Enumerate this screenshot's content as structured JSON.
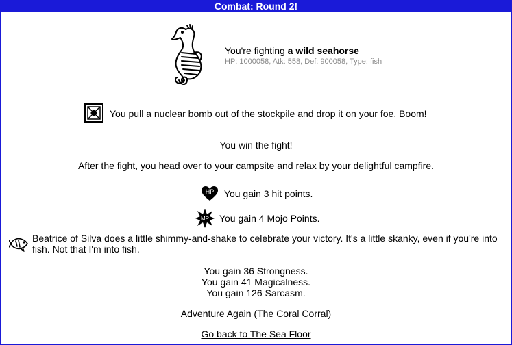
{
  "title": "Combat: Round 2!",
  "monster": {
    "icon": "seahorse-icon",
    "intro": "You're fighting ",
    "name": "a wild seahorse",
    "stats": "HP: 1000058, Atk: 558, Def: 900058, Type: fish"
  },
  "action": {
    "icon": "nuclear-bomb-crate-icon",
    "text": "You pull a nuclear bomb out of the stockpile and drop it on your foe. Boom!"
  },
  "result": {
    "win": "You win the fight!",
    "after": "After the fight, you head over to your campsite and relax by your delightful campfire."
  },
  "gains": {
    "hp_icon_label": "HP",
    "hp_text": "You gain 3 hit points.",
    "mp_icon_label": "MP",
    "mp_text": "You gain 4 Mojo Points."
  },
  "familiar": {
    "icon": "fish-familiar-icon",
    "text": "Beatrice of Silva does a little shimmy-and-shake to celebrate your victory. It's a little skanky, even if you're into fish. Not that I'm into fish."
  },
  "stats": {
    "strongness": "You gain 36 Strongness.",
    "magicalness": "You gain 41 Magicalness.",
    "sarcasm": "You gain 126 Sarcasm."
  },
  "links": {
    "adventure_again": "Adventure Again (The Coral Corral)",
    "go_back": "Go back to The Sea Floor"
  },
  "colors": {
    "titlebar": "#1a1ad8",
    "stats_text": "#888888"
  }
}
